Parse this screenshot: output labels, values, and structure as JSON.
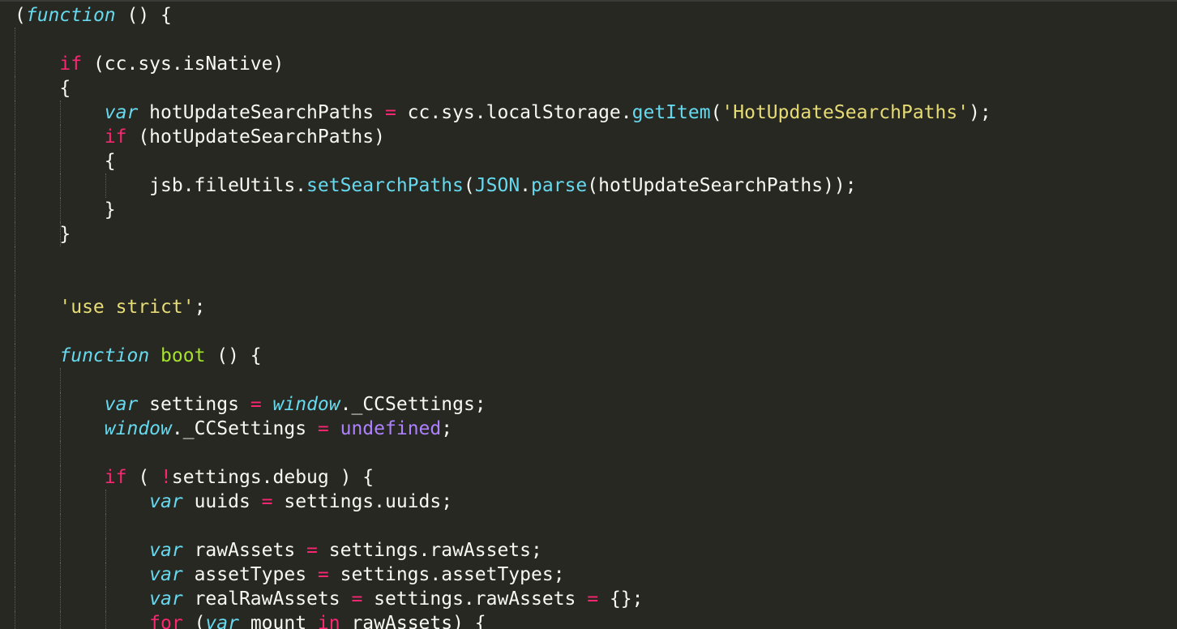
{
  "editor": {
    "theme": "monokai",
    "colors": {
      "background": "#272822",
      "foreground": "#f8f8f2",
      "keyword": "#f92672",
      "storage": "#66d9ef",
      "string": "#e6db74",
      "function_name": "#a6e22e",
      "constant": "#ae81ff"
    },
    "lines": [
      {
        "indent": 0,
        "tokens": [
          {
            "t": "pl",
            "v": "("
          },
          {
            "t": "stor",
            "v": "function"
          },
          {
            "t": "pl",
            "v": " () {"
          }
        ]
      },
      {
        "indent": 0,
        "tokens": []
      },
      {
        "indent": 1,
        "tokens": [
          {
            "t": "kw",
            "v": "if"
          },
          {
            "t": "pl",
            "v": " (cc.sys.isNative)"
          }
        ]
      },
      {
        "indent": 1,
        "tokens": [
          {
            "t": "pl",
            "v": "{"
          }
        ]
      },
      {
        "indent": 2,
        "tokens": [
          {
            "t": "stor",
            "v": "var"
          },
          {
            "t": "pl",
            "v": " hotUpdateSearchPaths "
          },
          {
            "t": "op",
            "v": "="
          },
          {
            "t": "pl",
            "v": " cc.sys.localStorage."
          },
          {
            "t": "fn",
            "v": "getItem"
          },
          {
            "t": "pl",
            "v": "("
          },
          {
            "t": "str",
            "v": "'HotUpdateSearchPaths'"
          },
          {
            "t": "pl",
            "v": ");"
          }
        ]
      },
      {
        "indent": 2,
        "tokens": [
          {
            "t": "kw",
            "v": "if"
          },
          {
            "t": "pl",
            "v": " (hotUpdateSearchPaths)"
          }
        ]
      },
      {
        "indent": 2,
        "tokens": [
          {
            "t": "pl",
            "v": "{"
          }
        ]
      },
      {
        "indent": 3,
        "tokens": [
          {
            "t": "pl",
            "v": "jsb.fileUtils."
          },
          {
            "t": "fn",
            "v": "setSearchPaths"
          },
          {
            "t": "pl",
            "v": "("
          },
          {
            "t": "fn",
            "v": "JSON"
          },
          {
            "t": "pl",
            "v": "."
          },
          {
            "t": "fn",
            "v": "parse"
          },
          {
            "t": "pl",
            "v": "(hotUpdateSearchPaths));"
          }
        ]
      },
      {
        "indent": 2,
        "tokens": [
          {
            "t": "pl",
            "v": "}"
          }
        ]
      },
      {
        "indent": 1,
        "tokens": [
          {
            "t": "pl",
            "v": "}"
          }
        ]
      },
      {
        "indent": 0,
        "tokens": []
      },
      {
        "indent": 0,
        "tokens": []
      },
      {
        "indent": 1,
        "tokens": [
          {
            "t": "str",
            "v": "'use strict'"
          },
          {
            "t": "pl",
            "v": ";"
          }
        ]
      },
      {
        "indent": 0,
        "tokens": []
      },
      {
        "indent": 1,
        "tokens": [
          {
            "t": "stor",
            "v": "function"
          },
          {
            "t": "pl",
            "v": " "
          },
          {
            "t": "def",
            "v": "boot"
          },
          {
            "t": "pl",
            "v": " () {"
          }
        ]
      },
      {
        "indent": 0,
        "tokens": []
      },
      {
        "indent": 2,
        "tokens": [
          {
            "t": "stor",
            "v": "var"
          },
          {
            "t": "pl",
            "v": " settings "
          },
          {
            "t": "op",
            "v": "="
          },
          {
            "t": "pl",
            "v": " "
          },
          {
            "t": "stor",
            "v": "window"
          },
          {
            "t": "pl",
            "v": "._CCSettings;"
          }
        ]
      },
      {
        "indent": 2,
        "tokens": [
          {
            "t": "stor",
            "v": "window"
          },
          {
            "t": "pl",
            "v": "._CCSettings "
          },
          {
            "t": "op",
            "v": "="
          },
          {
            "t": "pl",
            "v": " "
          },
          {
            "t": "const",
            "v": "undefined"
          },
          {
            "t": "pl",
            "v": ";"
          }
        ]
      },
      {
        "indent": 0,
        "tokens": []
      },
      {
        "indent": 2,
        "tokens": [
          {
            "t": "kw",
            "v": "if"
          },
          {
            "t": "pl",
            "v": " ( "
          },
          {
            "t": "op",
            "v": "!"
          },
          {
            "t": "pl",
            "v": "settings.debug ) {"
          }
        ]
      },
      {
        "indent": 3,
        "tokens": [
          {
            "t": "stor",
            "v": "var"
          },
          {
            "t": "pl",
            "v": " uuids "
          },
          {
            "t": "op",
            "v": "="
          },
          {
            "t": "pl",
            "v": " settings.uuids;"
          }
        ]
      },
      {
        "indent": 0,
        "tokens": []
      },
      {
        "indent": 3,
        "tokens": [
          {
            "t": "stor",
            "v": "var"
          },
          {
            "t": "pl",
            "v": " rawAssets "
          },
          {
            "t": "op",
            "v": "="
          },
          {
            "t": "pl",
            "v": " settings.rawAssets;"
          }
        ]
      },
      {
        "indent": 3,
        "tokens": [
          {
            "t": "stor",
            "v": "var"
          },
          {
            "t": "pl",
            "v": " assetTypes "
          },
          {
            "t": "op",
            "v": "="
          },
          {
            "t": "pl",
            "v": " settings.assetTypes;"
          }
        ]
      },
      {
        "indent": 3,
        "tokens": [
          {
            "t": "stor",
            "v": "var"
          },
          {
            "t": "pl",
            "v": " realRawAssets "
          },
          {
            "t": "op",
            "v": "="
          },
          {
            "t": "pl",
            "v": " settings.rawAssets "
          },
          {
            "t": "op",
            "v": "="
          },
          {
            "t": "pl",
            "v": " {};"
          }
        ]
      },
      {
        "indent": 3,
        "tokens": [
          {
            "t": "kw",
            "v": "for"
          },
          {
            "t": "pl",
            "v": " ("
          },
          {
            "t": "stor",
            "v": "var"
          },
          {
            "t": "pl",
            "v": " mount "
          },
          {
            "t": "kw",
            "v": "in"
          },
          {
            "t": "pl",
            "v": " rawAssets) {"
          }
        ]
      }
    ],
    "guides": [
      {
        "level": 1,
        "from": 1,
        "to": 25
      },
      {
        "level": 2,
        "from": 4,
        "to": 9
      },
      {
        "level": 3,
        "from": 7,
        "to": 7
      },
      {
        "level": 2,
        "from": 15,
        "to": 25
      },
      {
        "level": 3,
        "from": 20,
        "to": 25
      }
    ]
  }
}
